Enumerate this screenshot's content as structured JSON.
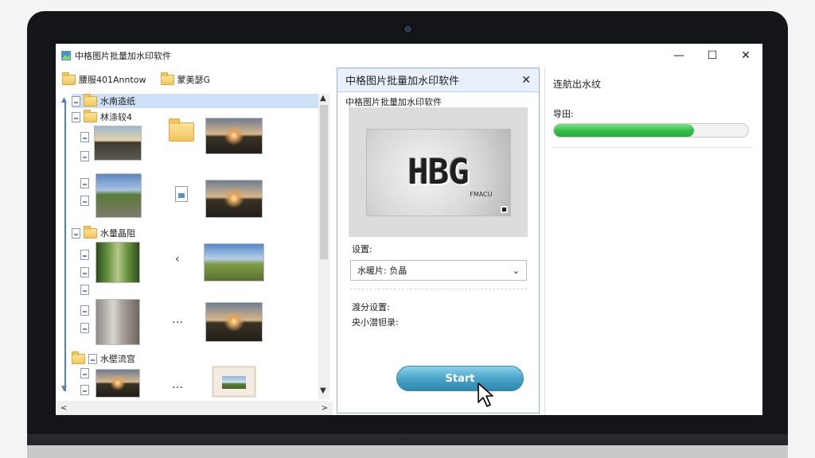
{
  "app": {
    "title": "中格图片批量加水印软件",
    "window_controls": [
      "—",
      "☐",
      "✕"
    ]
  },
  "explorer": {
    "toolbar": [
      {
        "label": "腰服401Anntow"
      },
      {
        "label": "蒙美瑟G"
      }
    ],
    "tree": [
      {
        "label": "水南造纸",
        "selected": true
      },
      {
        "label": "林涤较4"
      },
      {
        "label": "水量晶阻"
      },
      {
        "label": "水壁流宫"
      }
    ],
    "scroll": {
      "up": "▲",
      "down": "▼",
      "left": "<",
      "right": ">"
    },
    "nav_glyphs": {
      "back": "‹",
      "more1": "…",
      "more2": "…"
    }
  },
  "dialog": {
    "title": "中格图片批量加水印软件",
    "close": "✕",
    "subtitle": "中格图片批量加水印软件",
    "watermark_text": "HBG",
    "watermark_small": "FMACU",
    "settings_label": "设置:",
    "select_value": "水暖片: 负晶",
    "select_arrow": "⌄",
    "advanced_label": "渡分设置:",
    "size_label": "央小潜钽录:",
    "start_label": "Start"
  },
  "progress": {
    "title": "连航出水纹",
    "label": "导田:",
    "value": 0.72,
    "accent": "#36c04b"
  }
}
